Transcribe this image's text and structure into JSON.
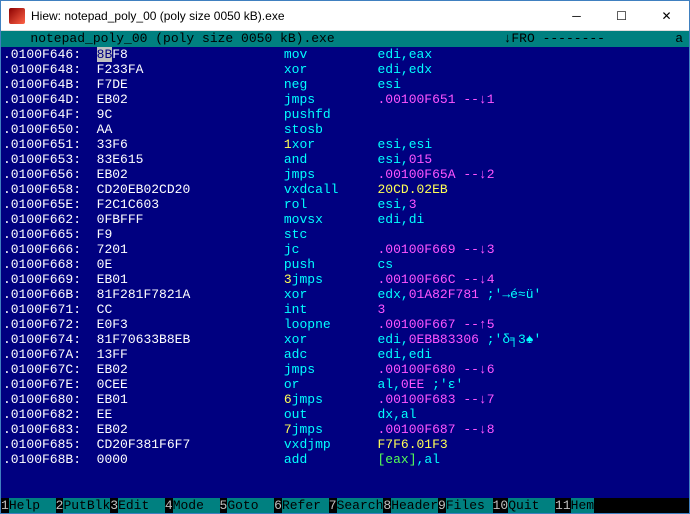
{
  "window": {
    "title": "Hiew: notepad_poly_00 (poly size 0050 kB).exe"
  },
  "header": {
    "filename": "   notepad_poly_00 (poly size 0050 kB).exe",
    "right": "↓FRO --------         a"
  },
  "rows": [
    {
      "addr": ".0100F646:",
      "hex": "8BF8",
      "cur": "8B",
      "mn": "mov",
      "ops": "edi,eax"
    },
    {
      "addr": ".0100F648:",
      "hex": "F233FA",
      "mn": "xor",
      "ops": "edi,edx"
    },
    {
      "addr": ".0100F64B:",
      "hex": "F7DE",
      "mn": "neg",
      "ops": "esi"
    },
    {
      "addr": ".0100F64D:",
      "hex": "EB02",
      "mn": "jmps",
      "jmp": ".00100F651 --↓1"
    },
    {
      "addr": ".0100F64F:",
      "hex": "9C",
      "mn": "pushfd"
    },
    {
      "addr": ".0100F650:",
      "hex": "AA",
      "mn": "stosb"
    },
    {
      "addr": ".0100F651:",
      "hex": "33F6",
      "pre": "1",
      "mn": "xor",
      "ops": "esi,esi"
    },
    {
      "addr": ".0100F653:",
      "hex": "83E615",
      "mn": "and",
      "ops": "esi,",
      "imm": "015"
    },
    {
      "addr": ".0100F656:",
      "hex": "EB02",
      "mn": "jmps",
      "jmp": ".00100F65A --↓2"
    },
    {
      "addr": ".0100F658:",
      "hex": "CD20EB02CD20",
      "mn": "vxdcall",
      "yop": "20CD.02EB"
    },
    {
      "addr": ".0100F65E:",
      "hex": "F2C1C603",
      "mn": "rol",
      "ops": "esi,",
      "imm": "3"
    },
    {
      "addr": ".0100F662:",
      "hex": "0FBFFF",
      "mn": "movsx",
      "ops": "edi,di"
    },
    {
      "addr": ".0100F665:",
      "hex": "F9",
      "mn": "stc"
    },
    {
      "addr": ".0100F666:",
      "hex": "7201",
      "mn": "jc",
      "jmp": ".00100F669 --↓3"
    },
    {
      "addr": ".0100F668:",
      "hex": "0E",
      "mn": "push",
      "ops": "cs"
    },
    {
      "addr": ".0100F669:",
      "hex": "EB01",
      "pre": "3",
      "mn": "jmps",
      "jmp": ".00100F66C --↓4"
    },
    {
      "addr": ".0100F66B:",
      "hex": "81F281F7821A",
      "mn": "xor",
      "ops": "edx,",
      "imm": "01A82F781",
      "com": " ;'→é≈ü'"
    },
    {
      "addr": ".0100F671:",
      "hex": "CC",
      "mn": "int",
      "imm": "3"
    },
    {
      "addr": ".0100F672:",
      "hex": "E0F3",
      "mn": "loopne",
      "jmp": ".00100F667 --↑5"
    },
    {
      "addr": ".0100F674:",
      "hex": "81F70633B8EB",
      "mn": "xor",
      "ops": "edi,",
      "imm": "0EBB83306",
      "com": " ;'δ╕3♠'"
    },
    {
      "addr": ".0100F67A:",
      "hex": "13FF",
      "mn": "adc",
      "ops": "edi,edi"
    },
    {
      "addr": ".0100F67C:",
      "hex": "EB02",
      "mn": "jmps",
      "jmp": ".00100F680 --↓6"
    },
    {
      "addr": ".0100F67E:",
      "hex": "0CEE",
      "mn": "or",
      "ops": "al,",
      "imm": "0EE",
      "com": " ;'ε'"
    },
    {
      "addr": ".0100F680:",
      "hex": "EB01",
      "pre": "6",
      "mn": "jmps",
      "jmp": ".00100F683 --↓7"
    },
    {
      "addr": ".0100F682:",
      "hex": "EE",
      "mn": "out",
      "ops": "dx,al"
    },
    {
      "addr": ".0100F683:",
      "hex": "EB02",
      "pre": "7",
      "mn": "jmps",
      "jmp": ".00100F687 --↓8"
    },
    {
      "addr": ".0100F685:",
      "hex": "CD20F381F6F7",
      "mn": "vxdjmp",
      "yop": "F7F6.01F3"
    },
    {
      "addr": ".0100F68B:",
      "hex": "0000",
      "mn": "add",
      "ops2": "[eax]",
      "ops3": ",al"
    }
  ],
  "fkeys": [
    {
      "n": "1",
      "l": "Help  "
    },
    {
      "n": "2",
      "l": "PutBlk"
    },
    {
      "n": "3",
      "l": "Edit  "
    },
    {
      "n": "4",
      "l": "Mode  "
    },
    {
      "n": "5",
      "l": "Goto  "
    },
    {
      "n": "6",
      "l": "Refer "
    },
    {
      "n": "7",
      "l": "Search"
    },
    {
      "n": "8",
      "l": "Header"
    },
    {
      "n": "9",
      "l": "Files "
    },
    {
      "n": "10",
      "l": "Quit  "
    },
    {
      "n": "11",
      "l": "Hem"
    }
  ]
}
